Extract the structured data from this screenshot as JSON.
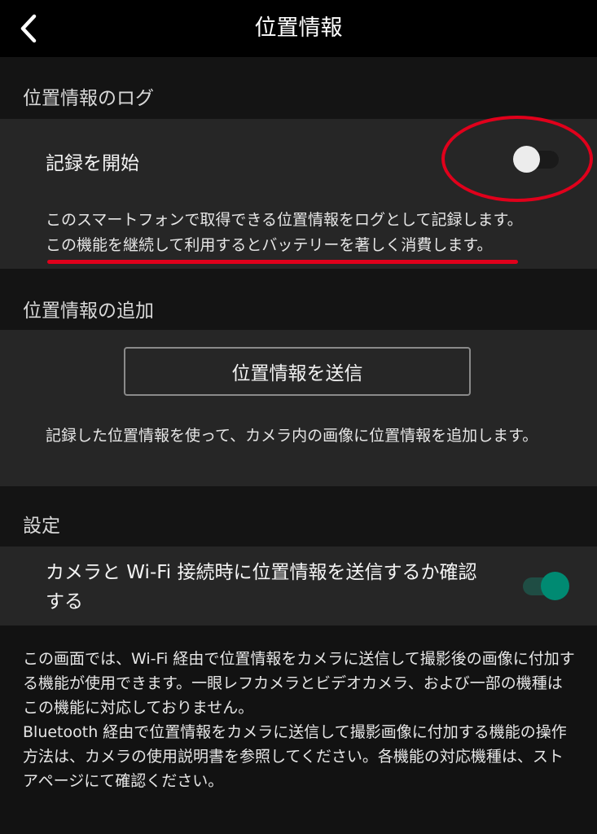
{
  "header": {
    "title": "位置情報",
    "back_icon": "chevron-left-icon"
  },
  "log_section": {
    "header": "位置情報のログ",
    "start_label": "記録を開始",
    "start_toggle": {
      "state": "off"
    },
    "description_line1": "このスマートフォンで取得できる位置情報をログとして記録します。",
    "description_line2": "この機能を継続して利用するとバッテリーを著しく消費します。"
  },
  "add_section": {
    "header": "位置情報の追加",
    "send_button_label": "位置情報を送信",
    "description": "記録した位置情報を使って、カメラ内の画像に位置情報を追加します。"
  },
  "settings_section": {
    "header": "設定",
    "confirm_label": "カメラと Wi-Fi 接続時に位置情報を送信するか確認する",
    "confirm_toggle": {
      "state": "on"
    }
  },
  "footer": {
    "text": "この画面では、Wi-Fi 経由で位置情報をカメラに送信して撮影後の画像に付加する機能が使用できます。一眼レフカメラとビデオカメラ、および一部の機種はこの機能に対応しておりません。\nBluetooth 経由で位置情報をカメラに送信して撮影画像に付加する機能の操作方法は、カメラの使用説明書を参照してください。各機能の対応機種は、ストアページにて確認ください。"
  },
  "colors": {
    "background": "#121212",
    "topbar": "#000000",
    "card": "#262626",
    "accent_on": "#008a72",
    "annotation": "#e0001b"
  }
}
